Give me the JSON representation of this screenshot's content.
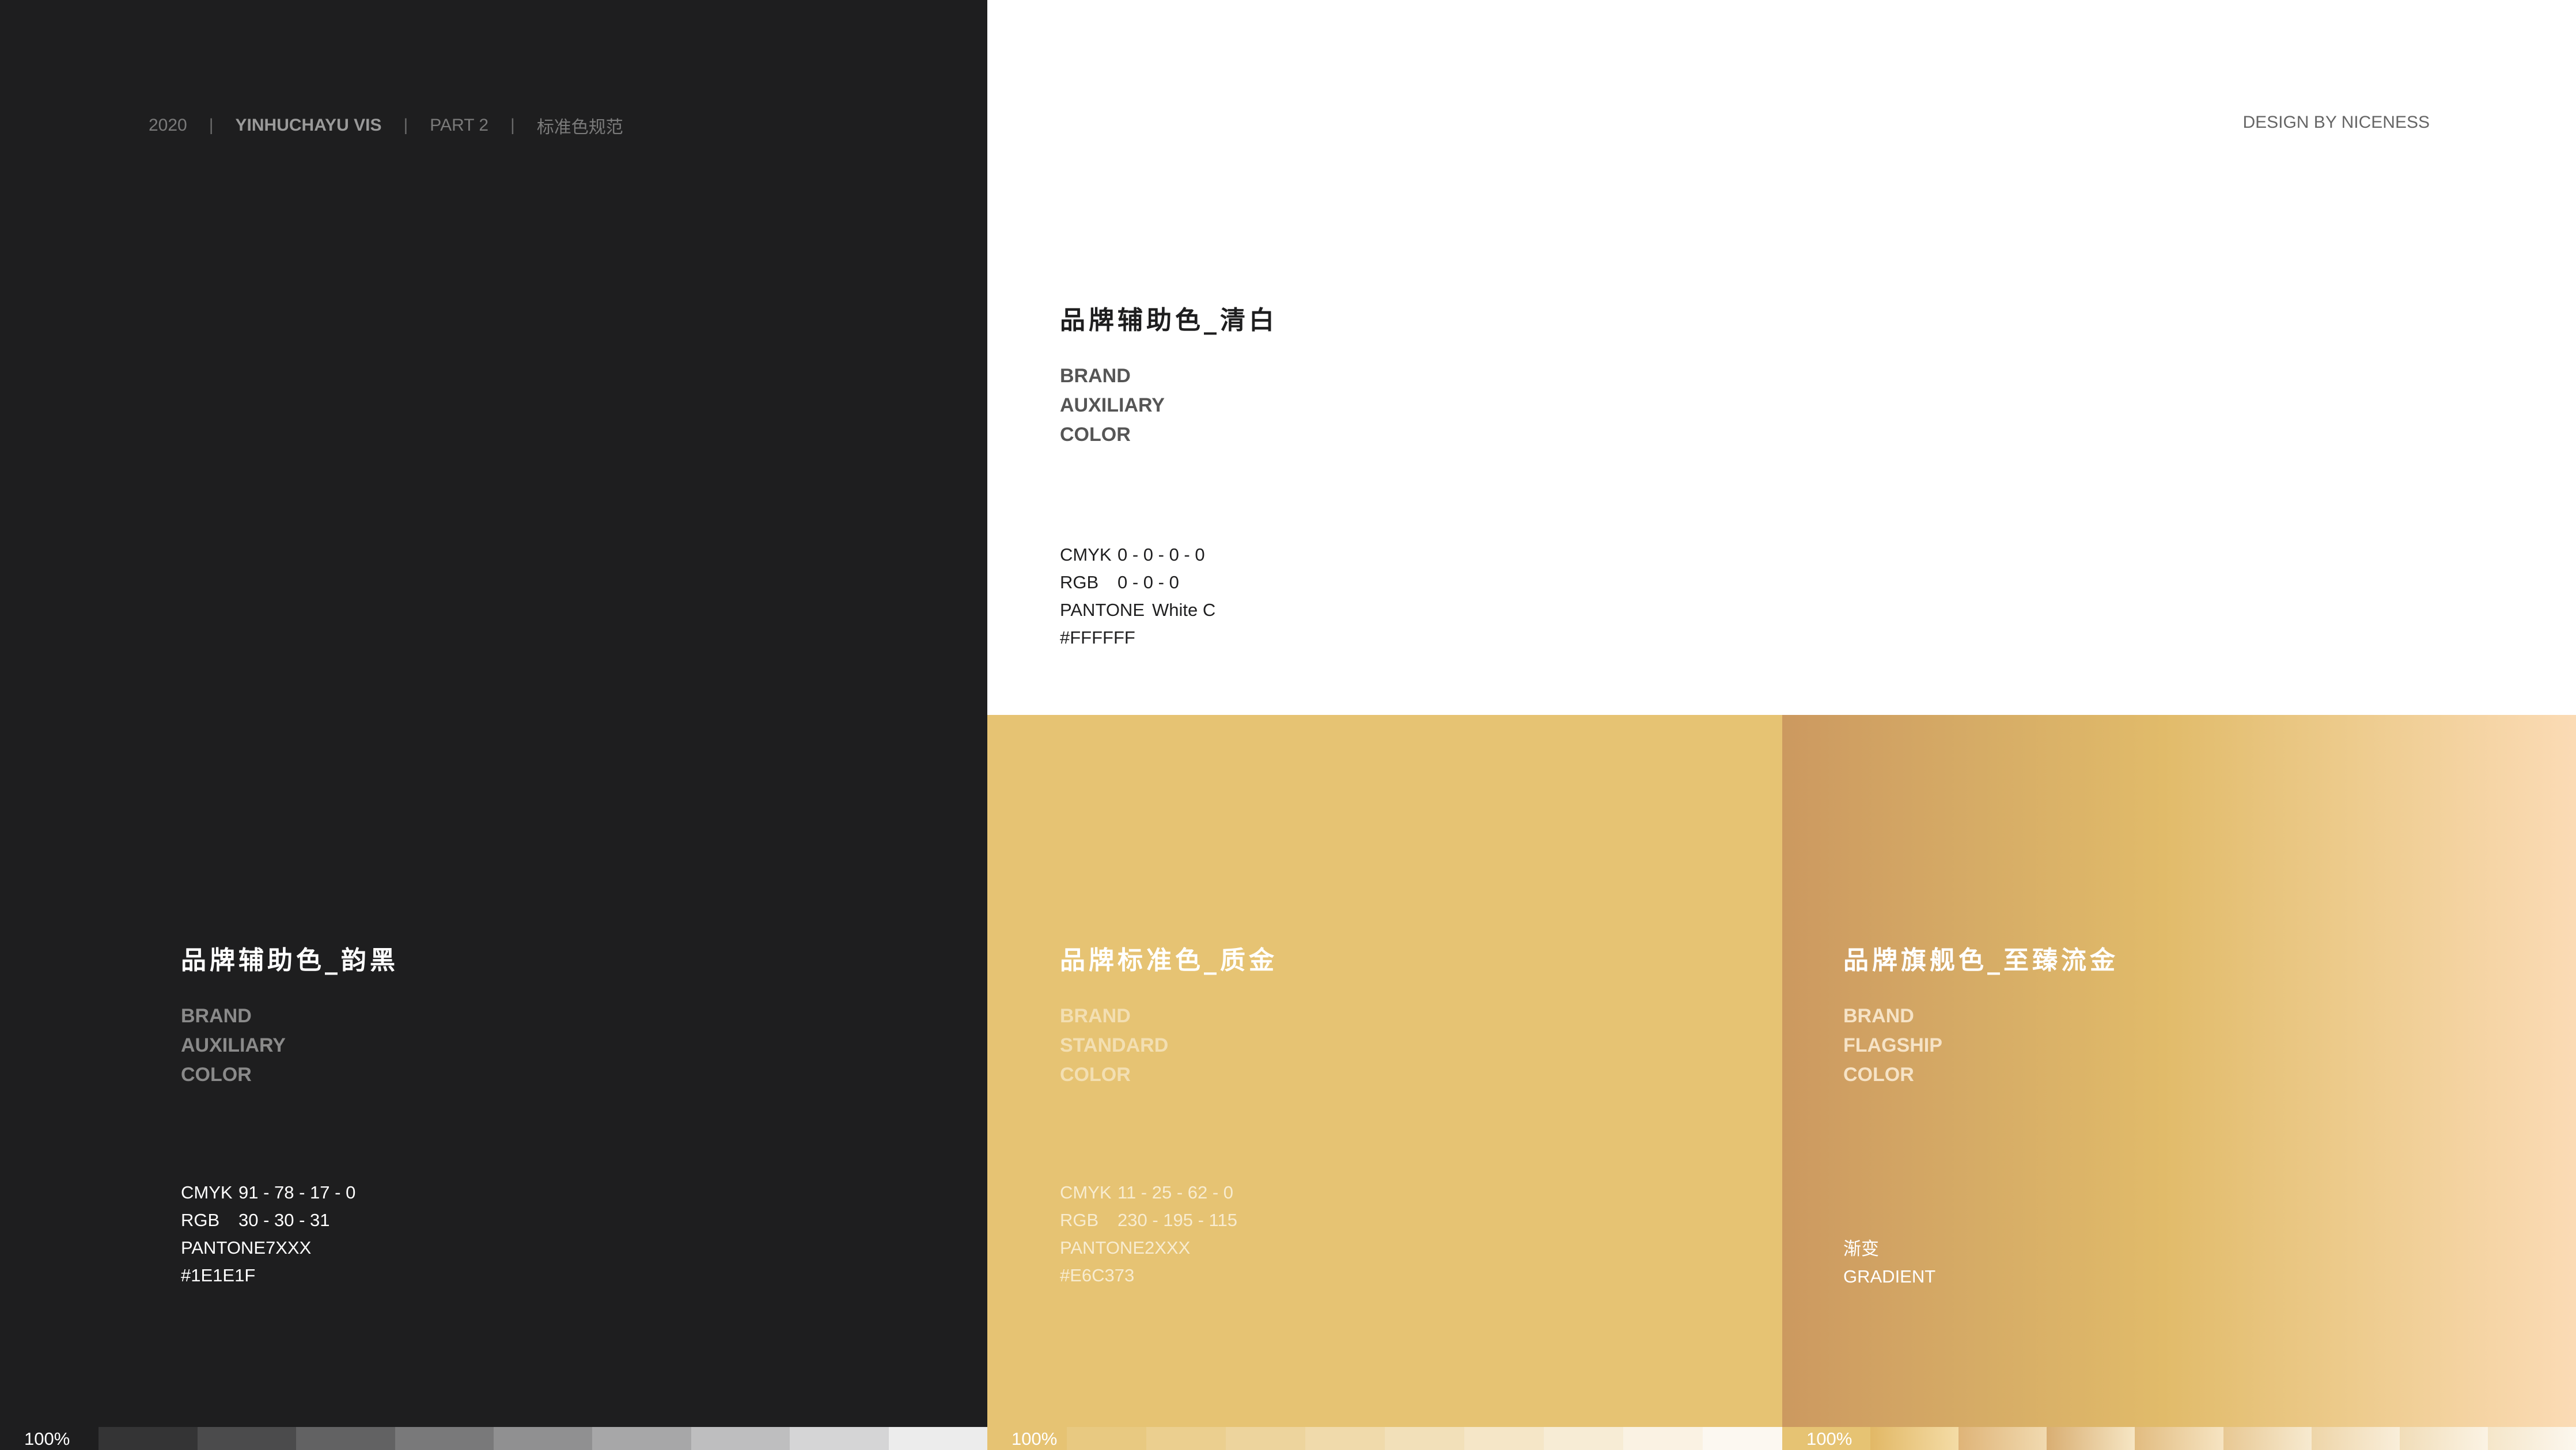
{
  "header": {
    "year": "2020",
    "separator": "|",
    "brand": "YINHUCHAYU VIS",
    "part": "PART 2",
    "section": "标准色规范",
    "credit": "DESIGN BY NICENESS"
  },
  "colors": {
    "black": "#1E1E1F",
    "white": "#FFFFFF",
    "gold": "#E6C373",
    "gradient": [
      "#CC9960",
      "#E1BB6A",
      "#FBDBB5"
    ]
  },
  "black_panel": {
    "title": "品牌辅助色_韵黑",
    "label": [
      "BRAND",
      "AUXILIARY",
      "COLOR"
    ],
    "cmyk_label": "CMYK",
    "cmyk": "91 - 78 - 17 - 0",
    "rgb_label": "RGB",
    "rgb": "30 - 30 - 31",
    "pantone_label": "PANTONE",
    "pantone": "7XXX",
    "hex": "#1E1E1F"
  },
  "white_panel": {
    "title": "品牌辅助色_清白",
    "label": [
      "BRAND",
      "AUXILIARY",
      "COLOR"
    ],
    "cmyk_label": "CMYK",
    "cmyk": "0 - 0 - 0 - 0",
    "rgb_label": "RGB",
    "rgb": "0 - 0 - 0",
    "pantone_label": "PANTONE",
    "pantone": "White C",
    "hex": "#FFFFFF"
  },
  "gold_panel": {
    "title": "品牌标准色_质金",
    "label": [
      "BRAND",
      "STANDARD",
      "COLOR"
    ],
    "cmyk_label": "CMYK",
    "cmyk": "11 - 25 - 62 - 0",
    "rgb_label": "RGB",
    "rgb": "230 - 195 - 115",
    "pantone_label": "PANTONE",
    "pantone": "2XXX",
    "hex": "#E6C373"
  },
  "gradient_panel": {
    "title": "品牌旗舰色_至臻流金",
    "label": [
      "BRAND",
      "FLAGSHIP",
      "COLOR"
    ],
    "type_cn": "渐变",
    "type_en": "GRADIENT"
  },
  "tint_strips": {
    "percent_label": "100%",
    "black": [
      "#1E1E1F",
      "#343435",
      "#4B4B4C",
      "#626263",
      "#79797A",
      "#909091",
      "#A7A7A8",
      "#BEBEBF",
      "#D5D5D6",
      "#ECECEC"
    ],
    "gold": [
      "#E6C373",
      "#E8C981",
      "#EBCF8F",
      "#EDD49D",
      "#F0DAAB",
      "#F2E0B9",
      "#F5E6C7",
      "#F7ECD5",
      "#FAF2E3",
      "#FCF8F1"
    ],
    "gradient": [
      [
        "#E6C373",
        "#E6C373"
      ],
      [
        "#E2B866",
        "#F4DCA6"
      ],
      [
        "#DFB478",
        "#F1DAB0"
      ],
      [
        "#D9AE72",
        "#F6E6C4"
      ],
      [
        "#E2BC80",
        "#F6E4C2"
      ],
      [
        "#E8C893",
        "#F7EAD0"
      ],
      [
        "#EED5A8",
        "#F9EEDA"
      ],
      [
        "#F1DDB8",
        "#FBF3E4"
      ],
      [
        "#F5E6C9",
        "#FCF7EE"
      ]
    ]
  }
}
